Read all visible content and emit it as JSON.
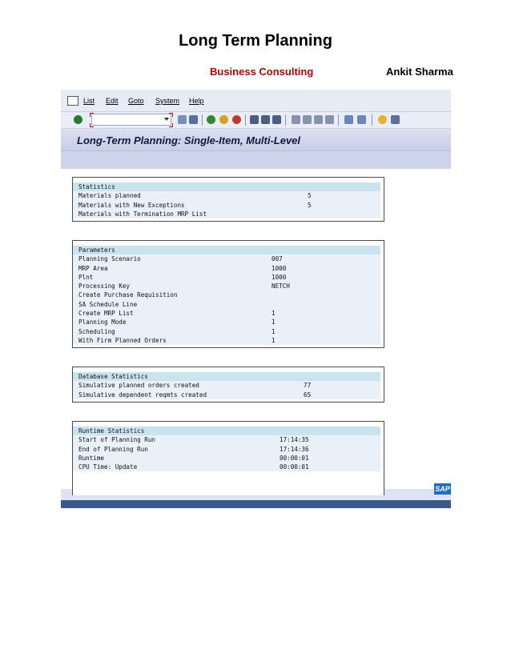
{
  "document": {
    "title": "Long Term Planning",
    "subtitle_left": "Business Consulting",
    "subtitle_right": "Ankit Sharma"
  },
  "menu": {
    "items": [
      "List",
      "Edit",
      "Goto",
      "System",
      "Help"
    ]
  },
  "window": {
    "title": "Long-Term Planning: Single-Item, Multi-Level"
  },
  "statistics": {
    "header": "Statistics",
    "rows": [
      {
        "label": "Materials planned",
        "value": "5"
      },
      {
        "label": "Materials with New Exceptions",
        "value": "5"
      },
      {
        "label": "Materials with Termination MRP List",
        "value": ""
      }
    ]
  },
  "parameters": {
    "header": "Parameters",
    "rows": [
      {
        "label": "Planning Scenario",
        "value": "007"
      },
      {
        "label": "MRP Area",
        "value": "1000"
      },
      {
        "label": "Plnt",
        "value": "1000"
      },
      {
        "label": "Processing Key",
        "value": "NETCH"
      },
      {
        "label": "Create Purchase Requisition",
        "value": ""
      },
      {
        "label": "SA Schedule Line",
        "value": ""
      },
      {
        "label": "Create MRP List",
        "value": "1"
      },
      {
        "label": "Planning Mode",
        "value": "1"
      },
      {
        "label": "Scheduling",
        "value": "1"
      },
      {
        "label": "With Firm Planned Orders",
        "value": "1"
      }
    ]
  },
  "database_statistics": {
    "header": "Database Statistics",
    "rows": [
      {
        "label": "Simulative planned orders created",
        "value": "77"
      },
      {
        "label": "Simulative dependent reqmts created",
        "value": "65"
      }
    ]
  },
  "runtime_statistics": {
    "header": "Runtime Statistics",
    "rows": [
      {
        "label": "Start of Planning Run",
        "value": "17:14:35"
      },
      {
        "label": "End of Planning Run",
        "value": "17:14:36"
      },
      {
        "label": "Runtime",
        "value": "00:00:01"
      },
      {
        "label": "CPU Time: Update",
        "value": "00:00:01"
      }
    ]
  },
  "branding": {
    "logo_text": "SAP"
  }
}
